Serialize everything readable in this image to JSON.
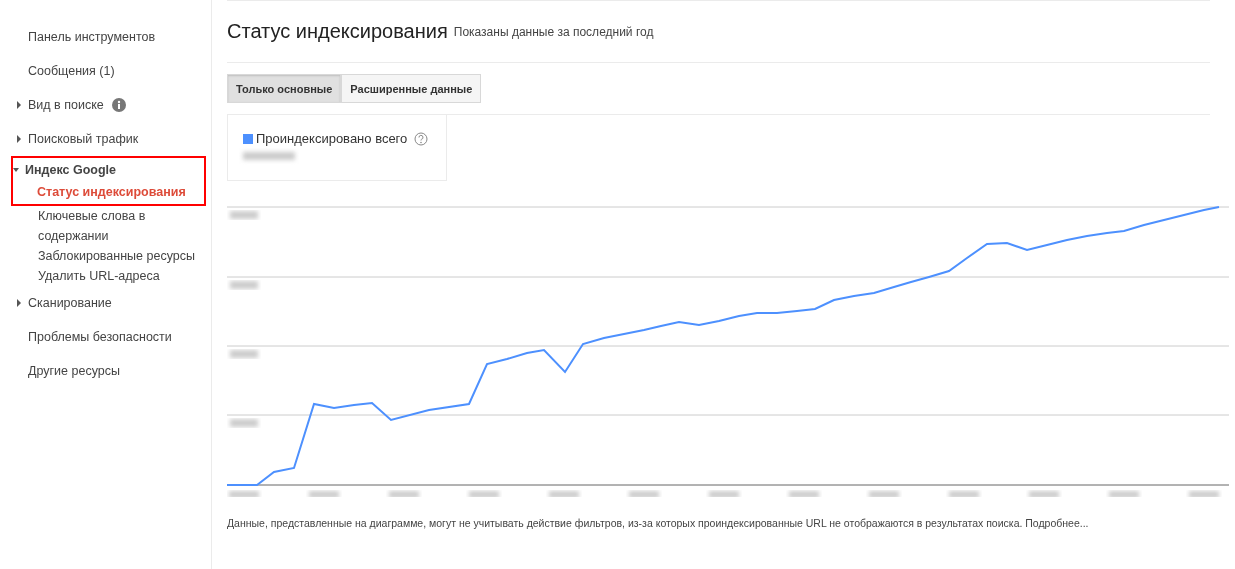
{
  "sidebar": {
    "items": [
      {
        "label": "Панель инструментов",
        "kind": "link"
      },
      {
        "label": "Сообщения (1)",
        "kind": "link"
      },
      {
        "label": "Вид в поиске",
        "kind": "group",
        "expanded": false,
        "info": true
      },
      {
        "label": "Поисковый трафик",
        "kind": "group",
        "expanded": false
      },
      {
        "label": "Индекс Google",
        "kind": "group",
        "expanded": true,
        "highlighted": true,
        "children": [
          {
            "label": "Статус индексирования",
            "selected": true
          },
          {
            "label": "Ключевые слова в содержании",
            "selected": false
          },
          {
            "label": "Заблокированные ресурсы",
            "selected": false
          },
          {
            "label": "Удалить URL-адреса",
            "selected": false
          }
        ]
      },
      {
        "label": "Сканирование",
        "kind": "group",
        "expanded": false
      },
      {
        "label": "Проблемы безопасности",
        "kind": "link"
      },
      {
        "label": "Другие ресурсы",
        "kind": "link"
      }
    ]
  },
  "header": {
    "title": "Статус индексирования",
    "subtitle": "Показаны данные за последний год"
  },
  "tabs": [
    {
      "label": "Только основные",
      "selected": true
    },
    {
      "label": "Расширенные данные",
      "selected": false
    }
  ],
  "legend": {
    "label": "Проиндексировано всего",
    "color": "#4d90fe"
  },
  "footnote": "Данные, представленные на диаграмме, могут не учитывать действие фильтров, из-за которых проиндексированные URL не отображаются в результатах поиска. Подробнее..."
}
